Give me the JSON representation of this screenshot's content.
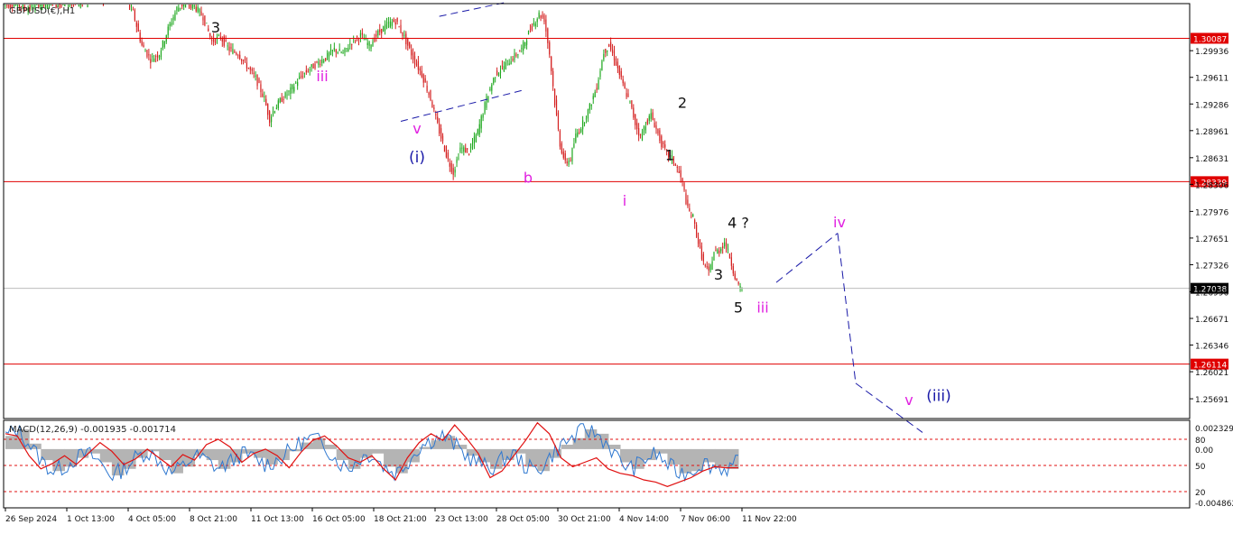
{
  "chart_title": "GBPUSD(€),H1",
  "macd_title": "MACD(12,26,9) -0.001935 -0.001714",
  "colors": {
    "bull": "#1fa81f",
    "bear": "#d42020",
    "level": "#e00000",
    "current": "#bdbdbd",
    "wave_minor": "#e020e0",
    "wave_major": "#1a1aa8",
    "wave_minute": "#111111",
    "projection": "#1a1aa8",
    "macd_hist": "#b4b4b4",
    "macd_line": "#2f78d0",
    "signal_line": "#e01010"
  },
  "chart_data": [
    {
      "type": "line",
      "name": "price",
      "symbol": "GBPUSD(€)",
      "timeframe": "H1",
      "ylim": [
        1.2545,
        1.3051
      ],
      "y_ticks": [
        "1.29936",
        "1.29611",
        "1.29286",
        "1.28961",
        "1.28631",
        "1.28306",
        "1.27976",
        "1.27651",
        "1.27326",
        "1.26996",
        "1.26671",
        "1.26346",
        "1.26021",
        "1.25691"
      ],
      "x_ticks": [
        "26 Sep 2024",
        "1 Oct 13:00",
        "4 Oct 05:00",
        "8 Oct 21:00",
        "11 Oct 13:00",
        "16 Oct 05:00",
        "18 Oct 21:00",
        "23 Oct 13:00",
        "28 Oct 05:00",
        "30 Oct 21:00",
        "4 Nov 14:00",
        "7 Nov 06:00",
        "11 Nov 22:00"
      ],
      "price_path": [
        [
          0,
          1.3051
        ],
        [
          5,
          1.3052
        ],
        [
          10,
          1.3049
        ],
        [
          15,
          1.3045
        ],
        [
          20,
          1.3051
        ],
        [
          25,
          1.3054
        ],
        [
          30,
          1.3052
        ],
        [
          35,
          1.3055
        ],
        [
          40,
          1.3053
        ],
        [
          45,
          1.3057
        ],
        [
          50,
          1.306
        ],
        [
          55,
          1.3058
        ],
        [
          60,
          1.3062
        ],
        [
          65,
          1.3065
        ],
        [
          70,
          1.3063
        ],
        [
          75,
          1.304
        ],
        [
          80,
          1.3
        ],
        [
          85,
          1.2983
        ],
        [
          90,
          1.299
        ],
        [
          95,
          1.302
        ],
        [
          100,
          1.3045
        ],
        [
          105,
          1.3052
        ],
        [
          110,
          1.3048
        ],
        [
          115,
          1.3035
        ],
        [
          120,
          1.3005
        ],
        [
          125,
          1.301
        ],
        [
          130,
          1.2995
        ],
        [
          135,
          1.299
        ],
        [
          140,
          1.2975
        ],
        [
          145,
          1.296
        ],
        [
          150,
          1.2935
        ],
        [
          153,
          1.291
        ],
        [
          155,
          1.292
        ],
        [
          160,
          1.2935
        ],
        [
          165,
          1.2945
        ],
        [
          170,
          1.296
        ],
        [
          175,
          1.297
        ],
        [
          180,
          1.2978
        ],
        [
          185,
          1.2985
        ],
        [
          190,
          1.2995
        ],
        [
          195,
          1.299
        ],
        [
          200,
          1.3005
        ],
        [
          205,
          1.3012
        ],
        [
          210,
          1.3
        ],
        [
          215,
          1.3015
        ],
        [
          220,
          1.3025
        ],
        [
          225,
          1.303
        ],
        [
          230,
          1.301
        ],
        [
          235,
          1.2985
        ],
        [
          240,
          1.2965
        ],
        [
          245,
          1.2935
        ],
        [
          250,
          1.2895
        ],
        [
          255,
          1.286
        ],
        [
          258,
          1.2845
        ],
        [
          262,
          1.2875
        ],
        [
          267,
          1.287
        ],
        [
          272,
          1.2895
        ],
        [
          277,
          1.2935
        ],
        [
          282,
          1.2965
        ],
        [
          287,
          1.2975
        ],
        [
          292,
          1.2985
        ],
        [
          297,
          1.2995
        ],
        [
          302,
          1.302
        ],
        [
          307,
          1.3038
        ],
        [
          310,
          1.3032
        ],
        [
          313,
          1.299
        ],
        [
          316,
          1.293
        ],
        [
          319,
          1.288
        ],
        [
          322,
          1.2856
        ],
        [
          325,
          1.2862
        ],
        [
          328,
          1.289
        ],
        [
          332,
          1.2905
        ],
        [
          336,
          1.2925
        ],
        [
          340,
          1.295
        ],
        [
          344,
          1.2992
        ],
        [
          347,
          1.3
        ],
        [
          350,
          1.2985
        ],
        [
          353,
          1.2965
        ],
        [
          356,
          1.2945
        ],
        [
          359,
          1.293
        ],
        [
          362,
          1.2905
        ],
        [
          365,
          1.2888
        ],
        [
          368,
          1.2905
        ],
        [
          371,
          1.2915
        ],
        [
          374,
          1.2898
        ],
        [
          377,
          1.288
        ],
        [
          380,
          1.2868
        ],
        [
          383,
          1.2862
        ],
        [
          386,
          1.285
        ],
        [
          389,
          1.2832
        ],
        [
          392,
          1.28
        ],
        [
          395,
          1.279
        ],
        [
          398,
          1.276
        ],
        [
          401,
          1.2735
        ],
        [
          404,
          1.2722
        ],
        [
          407,
          1.2748
        ],
        [
          410,
          1.275
        ],
        [
          413,
          1.276
        ],
        [
          416,
          1.2742
        ],
        [
          419,
          1.2718
        ],
        [
          421,
          1.2705
        ],
        [
          422,
          1.2704
        ]
      ],
      "horizontal_levels": [
        {
          "label": "1.30087",
          "value": 1.30087,
          "style": "solid-red"
        },
        {
          "label": "1.28339",
          "value": 1.28339,
          "style": "solid-red"
        },
        {
          "label": "1.27038",
          "value": 1.27038,
          "style": "current-price"
        },
        {
          "label": "1.26114",
          "value": 1.26114,
          "style": "solid-red"
        }
      ],
      "channel_lines": [
        [
          [
            227,
            1.29075
          ],
          [
            296,
            1.2945
          ]
        ],
        [
          [
            249,
            1.30355
          ],
          [
            286,
            1.3052
          ]
        ]
      ],
      "wave_projection": [
        [
          1.2688,
          1.2711
        ],
        [
          1.279,
          1.2771
        ],
        [
          1.271,
          1.2588
        ],
        [
          1.2639,
          1.2528
        ]
      ],
      "wave_labels": [
        {
          "text": "3",
          "color": "wave_minute",
          "t": 116,
          "p": 1.30225
        },
        {
          "text": "iii",
          "color": "wave_minor",
          "t": 176,
          "p": 1.2963
        },
        {
          "text": "v",
          "color": "wave_minor",
          "t": 227,
          "p": 1.2899
        },
        {
          "text": "(i)",
          "color": "wave_major",
          "t": 227,
          "p": 1.2864
        },
        {
          "text": "b",
          "color": "wave_minor",
          "t": 288,
          "p": 1.2839
        },
        {
          "text": "i",
          "color": "wave_minor",
          "t": 345,
          "p": 1.2811
        },
        {
          "text": "1",
          "color": "wave_minute",
          "t": 370,
          "p": 1.28665
        },
        {
          "text": "2",
          "color": "wave_minute",
          "t": 378,
          "p": 1.29305
        },
        {
          "text": "4 ?",
          "color": "wave_minute",
          "t": 411,
          "p": 1.2784
        },
        {
          "text": "3",
          "color": "wave_minute",
          "t": 398,
          "p": 1.2721
        },
        {
          "text": "5",
          "color": "wave_minute",
          "t": 409,
          "p": 1.2681
        },
        {
          "text": "iii",
          "color": "wave_minor",
          "t": 422,
          "p": 1.2681
        },
        {
          "text": "iv",
          "color": "wave_minor",
          "t": 464,
          "p": 1.2785
        },
        {
          "text": "v",
          "color": "wave_minor",
          "t": 503,
          "p": 1.2568
        },
        {
          "text": "(iii)",
          "color": "wave_major",
          "t": 520,
          "p": 1.2573
        }
      ]
    },
    {
      "type": "line",
      "name": "MACD(12,26,9)",
      "ylim": [
        -0.00535,
        0.00262
      ],
      "y_ticks": [
        "0.002329",
        "0.00",
        "-0.004862"
      ],
      "oscillator_levels": [
        "80",
        "50",
        "20"
      ],
      "series": [
        {
          "name": "MACD",
          "role": "histogram",
          "values": [
            0.0012,
            0.0018,
            0.0005,
            -0.001,
            -0.002,
            -0.0016,
            -0.0008,
            -0.0004,
            -0.0012,
            -0.0024,
            -0.0018,
            -0.0008,
            -0.0002,
            -0.001,
            -0.0022,
            -0.0016,
            -0.0006,
            -0.001,
            -0.0018,
            -0.0012,
            -0.0004,
            -0.0008,
            -0.0014,
            -0.001,
            -0.0002,
            0.0006,
            0.001,
            0.0004,
            -0.001,
            -0.0018,
            -0.0008,
            -0.0004,
            -0.0016,
            -0.0022,
            -0.0012,
            0.0002,
            0.0008,
            0.0012,
            0.0004,
            -0.0006,
            -0.0012,
            -0.0018,
            -0.001,
            -0.0004,
            -0.0016,
            -0.002,
            -0.0008,
            0.0004,
            0.001,
            0.0018,
            0.0014,
            0.0004,
            -0.0012,
            -0.0018,
            -0.001,
            -0.0004,
            -0.0014,
            -0.0022,
            -0.002,
            -0.0012,
            -0.0016,
            -0.0018,
            -0.0012
          ]
        },
        {
          "name": "Signal",
          "role": "signal",
          "values": [
            0.0014,
            0.0012,
            -0.0006,
            -0.0018,
            -0.0013,
            -0.0006,
            -0.0014,
            -0.0004,
            0.0006,
            -0.0002,
            -0.0014,
            -0.0009,
            0.0,
            -0.0008,
            -0.0016,
            -0.0005,
            -0.001,
            0.0004,
            0.0009,
            0.0002,
            -0.0012,
            -0.0004,
            0.0,
            -0.0006,
            -0.0017,
            -0.0003,
            0.0008,
            0.0012,
            0.0003,
            -0.0008,
            -0.0012,
            -0.0006,
            -0.0018,
            -0.0028,
            -0.0008,
            0.0006,
            0.0014,
            0.0008,
            0.0022,
            0.001,
            -0.0004,
            -0.0026,
            -0.002,
            -0.0006,
            0.0008,
            0.0024,
            0.0014,
            -0.0008,
            -0.0016,
            -0.0012,
            -0.0008,
            -0.0018,
            -0.0022,
            -0.0024,
            -0.0028,
            -0.003,
            -0.0034,
            -0.003,
            -0.0026,
            -0.002,
            -0.0016,
            -0.0017,
            -0.0017
          ]
        }
      ]
    }
  ]
}
